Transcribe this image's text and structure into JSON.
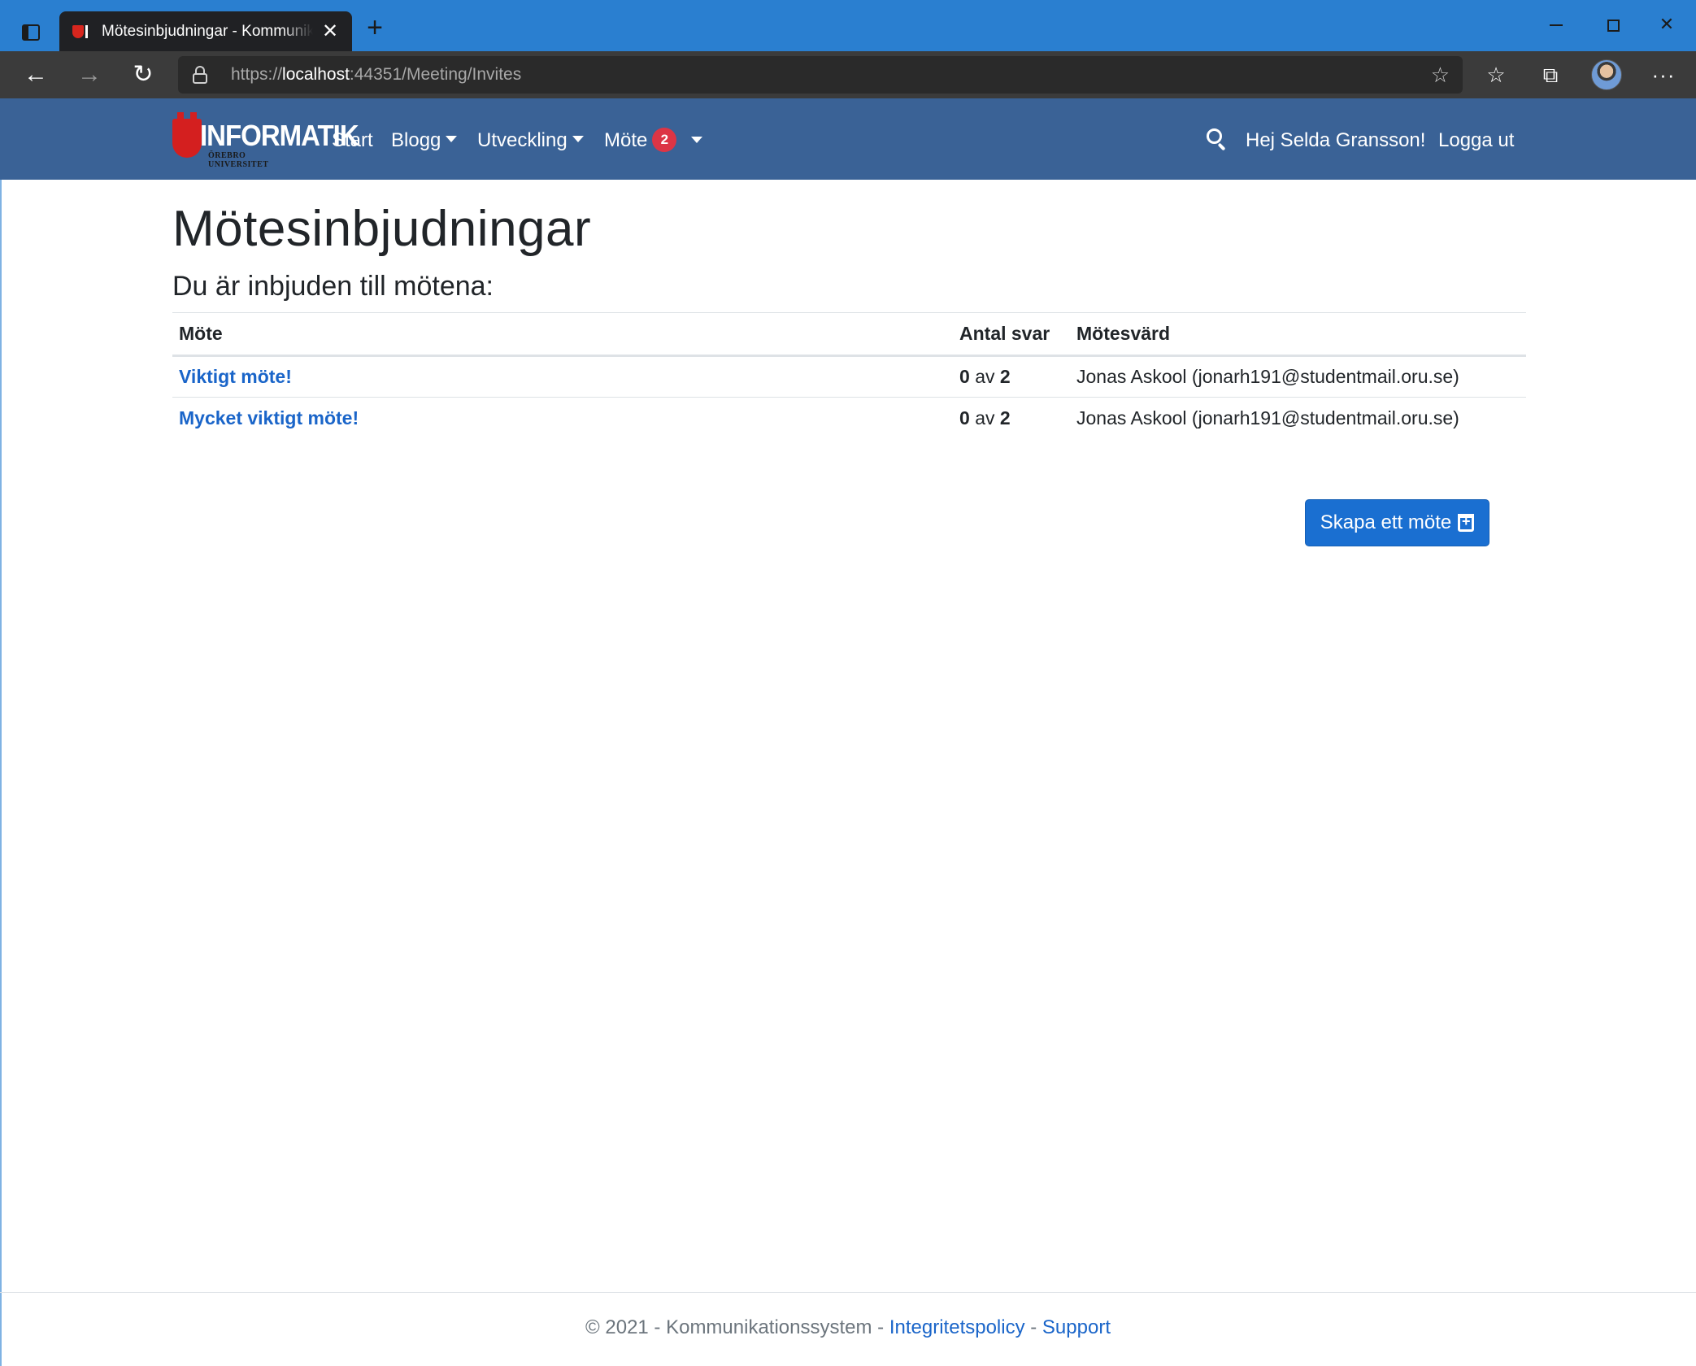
{
  "browser": {
    "tab_title": "Mötesinbjudningar - Kommunikationssystem",
    "url_prefix": "https://",
    "url_host": "localhost",
    "url_rest": ":44351/Meeting/Invites"
  },
  "nav": {
    "brand": "INFORMATIK",
    "brand_sub": "ÖREBRO UNIVERSITET",
    "start": "Start",
    "blogg": "Blogg",
    "utveckling": "Utveckling",
    "mote": "Möte",
    "mote_badge": "2",
    "greeting": "Hej Selda Gransson!",
    "logout": "Logga ut"
  },
  "main": {
    "title": "Mötesinbjudningar",
    "subtitle": "Du är inbjuden till mötena:",
    "columns": [
      "Möte",
      "Antal svar",
      "Mötesvärd"
    ],
    "rows": [
      {
        "name": "Viktigt möte!",
        "answered": "0",
        "of": "av",
        "total": "2",
        "host": "Jonas Askool (jonarh191@studentmail.oru.se)"
      },
      {
        "name": "Mycket viktigt möte!",
        "answered": "0",
        "of": "av",
        "total": "2",
        "host": "Jonas Askool (jonarh191@studentmail.oru.se)"
      }
    ],
    "create_button": "Skapa ett möte"
  },
  "footer": {
    "copyright": "© 2021 - Kommunikationssystem - ",
    "privacy": "Integritetspolicy",
    "separator": " - ",
    "support": "Support"
  },
  "colors": {
    "tabstrip": "#2a7fd0",
    "navbar": "#3a6296",
    "link": "#1a65c9",
    "button": "#1a6fd1",
    "badge": "#dc3545"
  }
}
